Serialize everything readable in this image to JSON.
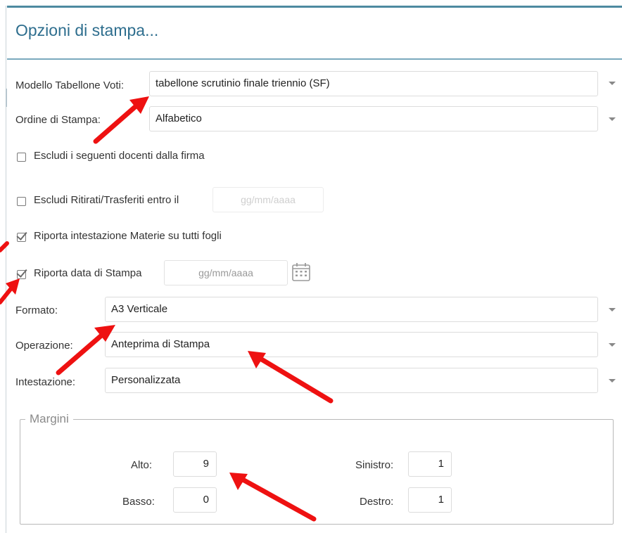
{
  "dialog": {
    "title": "Opzioni di stampa..."
  },
  "form": {
    "modello": {
      "label": "Modello Tabellone Voti:",
      "value": "tabellone scrutinio finale triennio (SF)"
    },
    "ordine": {
      "label": "Ordine di Stampa:",
      "value": "Alfabetico"
    },
    "escludi_docenti": {
      "label": "Escludi i seguenti docenti dalla firma",
      "checked": false
    },
    "escludi_ritirati": {
      "label": "Escludi Ritirati/Trasferiti entro il",
      "checked": false,
      "placeholder": "gg/mm/aaaa"
    },
    "riporta_intestazione": {
      "label": "Riporta intestazione Materie su tutti fogli",
      "checked": true
    },
    "riporta_data": {
      "label": "Riporta data di Stampa",
      "checked": true,
      "placeholder": "gg/mm/aaaa"
    },
    "formato": {
      "label": "Formato:",
      "value": "A3 Verticale"
    },
    "operazione": {
      "label": "Operazione:",
      "value": "Anteprima di Stampa"
    },
    "intestazione": {
      "label": "Intestazione:",
      "value": "Personalizzata"
    }
  },
  "margini": {
    "legend": "Margini",
    "alto": {
      "label": "Alto:",
      "value": "9"
    },
    "basso": {
      "label": "Basso:",
      "value": "0"
    },
    "sinistro": {
      "label": "Sinistro:",
      "value": "1"
    },
    "destro": {
      "label": "Destro:",
      "value": "1"
    }
  },
  "icons": {
    "dropdown": "chevron-down-icon",
    "calendar": "calendar-icon",
    "checkbox_checked": "checkmark-icon"
  },
  "colors": {
    "title": "#2e6e8e",
    "accent_line": "#4d8aa0",
    "annotation_arrow": "#ee1111"
  }
}
